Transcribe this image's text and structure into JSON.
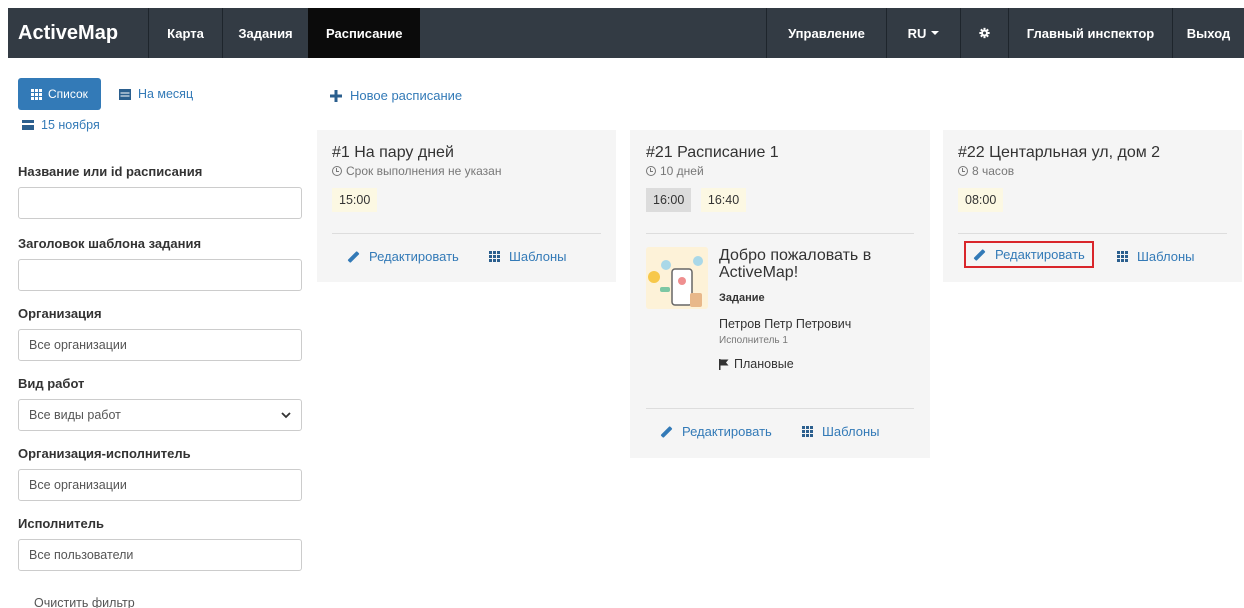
{
  "navbar": {
    "brand": "ActiveMap",
    "items": [
      "Карта",
      "Задания",
      "Расписание"
    ],
    "active_index": 2,
    "right": {
      "manage": "Управление",
      "lang": "RU",
      "user": "Главный инспектор",
      "logout": "Выход"
    }
  },
  "sidebar": {
    "list_button": "Список",
    "month_link": "На месяц",
    "date_link": "15 ноября",
    "filters": [
      {
        "label": "Название или id расписания",
        "value": ""
      },
      {
        "label": "Заголовок шаблона задания",
        "value": ""
      },
      {
        "label": "Организация",
        "value": "Все организации"
      },
      {
        "label": "Вид работ",
        "value": "Все виды работ"
      },
      {
        "label": "Организация-исполнитель",
        "value": "Все организации"
      },
      {
        "label": "Исполнитель",
        "value": "Все пользователи"
      }
    ],
    "clear_filter": "Очистить фильтр"
  },
  "main": {
    "new_schedule": "Новое расписание",
    "cards": [
      {
        "title": "#1 На пару дней",
        "duration": "Срок выполнения не указан",
        "times": [
          "15:00"
        ],
        "edit": "Редактировать",
        "templates": "Шаблоны"
      },
      {
        "title": "#21 Расписание 1",
        "duration": "10 дней",
        "times": [
          "16:00",
          "16:40"
        ],
        "task": {
          "title": "Добро пожаловать в ActiveMap!",
          "type": "Задание",
          "assignee": "Петров Петр Петрович",
          "assignee_role": "Исполнитель 1",
          "priority": "Плановые"
        },
        "edit": "Редактировать",
        "templates": "Шаблоны"
      },
      {
        "title": "#22 Центарльная ул, дом 2",
        "duration": "8 часов",
        "times": [
          "08:00"
        ],
        "edit": "Редактировать",
        "templates": "Шаблоны"
      }
    ]
  },
  "colors": {
    "navbar": "#333b44",
    "active": "#0b0b0b",
    "primary": "#337ab7",
    "time_yellow": "#fcf8e3",
    "time_gray": "#dcdcdc",
    "highlight": "#d9262b"
  }
}
